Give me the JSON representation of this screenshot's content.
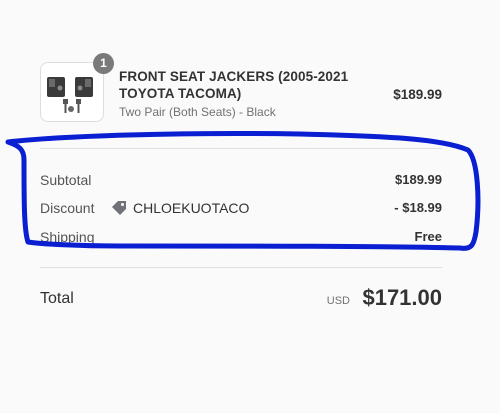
{
  "product": {
    "quantity": "1",
    "name": "FRONT SEAT JACKERS (2005-2021 TOYOTA TACOMA)",
    "variant": "Two Pair (Both Seats) - Black",
    "price": "$189.99",
    "image_icon": "seat-jacker-product-image"
  },
  "summary": {
    "subtotal_label": "Subtotal",
    "subtotal_value": "$189.99",
    "discount_label": "Discount",
    "discount_code": "CHLOEKUOTACO",
    "discount_icon": "tag-icon",
    "discount_value": "- $18.99",
    "shipping_label": "Shipping",
    "shipping_value": "Free"
  },
  "total": {
    "label": "Total",
    "currency": "USD",
    "amount": "$171.00"
  },
  "annotation": {
    "color": "#0a1ed2"
  }
}
